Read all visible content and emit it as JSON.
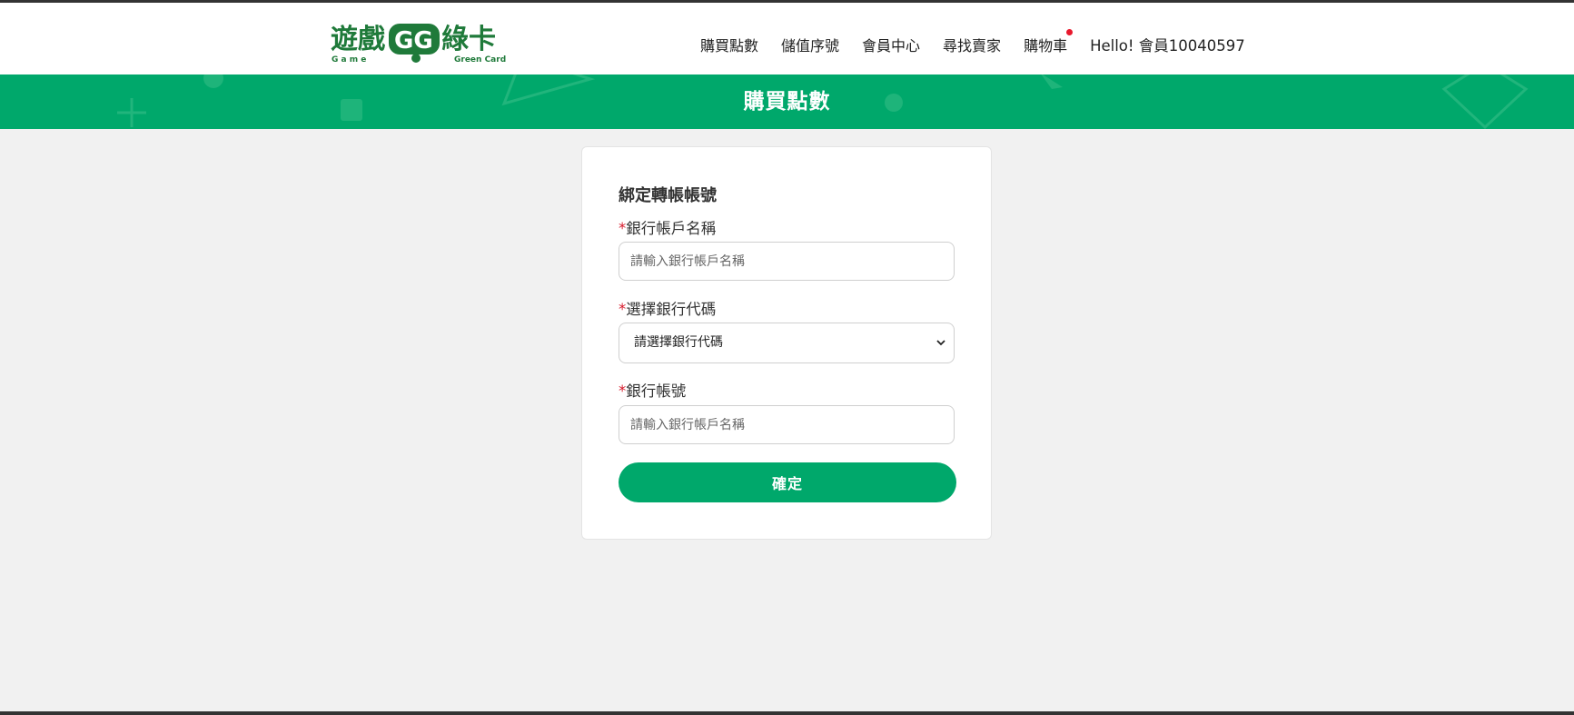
{
  "header": {
    "logo": {
      "main_text": "遊戲",
      "gg_text": "GG",
      "card_text": "綠卡",
      "sub_left": "G  a  m  e",
      "sub_right": "Green Card"
    },
    "nav": [
      {
        "label": "購買點數"
      },
      {
        "label": "儲值序號"
      },
      {
        "label": "會員中心"
      },
      {
        "label": "尋找賣家"
      },
      {
        "label": "購物車"
      }
    ],
    "greeting": "Hello! 會員10040597"
  },
  "banner": {
    "title": "購買點數"
  },
  "form": {
    "title": "綁定轉帳帳號",
    "required_mark": "*",
    "account_name": {
      "label": "銀行帳戶名稱",
      "placeholder": "請輸入銀行帳戶名稱",
      "value": ""
    },
    "bank_code": {
      "label": "選擇銀行代碼",
      "selected": "請選擇銀行代碼"
    },
    "account_number": {
      "label": "銀行帳號",
      "placeholder": "請輸入銀行帳戶名稱",
      "value": ""
    },
    "submit_label": "確定"
  },
  "colors": {
    "brand_green": "#00a86b",
    "logo_green": "#1f7a3a",
    "required_red": "#d7192a",
    "cart_badge": "#e8182c"
  },
  "icons": {
    "select_chevron": "chevron-down-icon",
    "cart_badge": "notification-dot-icon"
  }
}
